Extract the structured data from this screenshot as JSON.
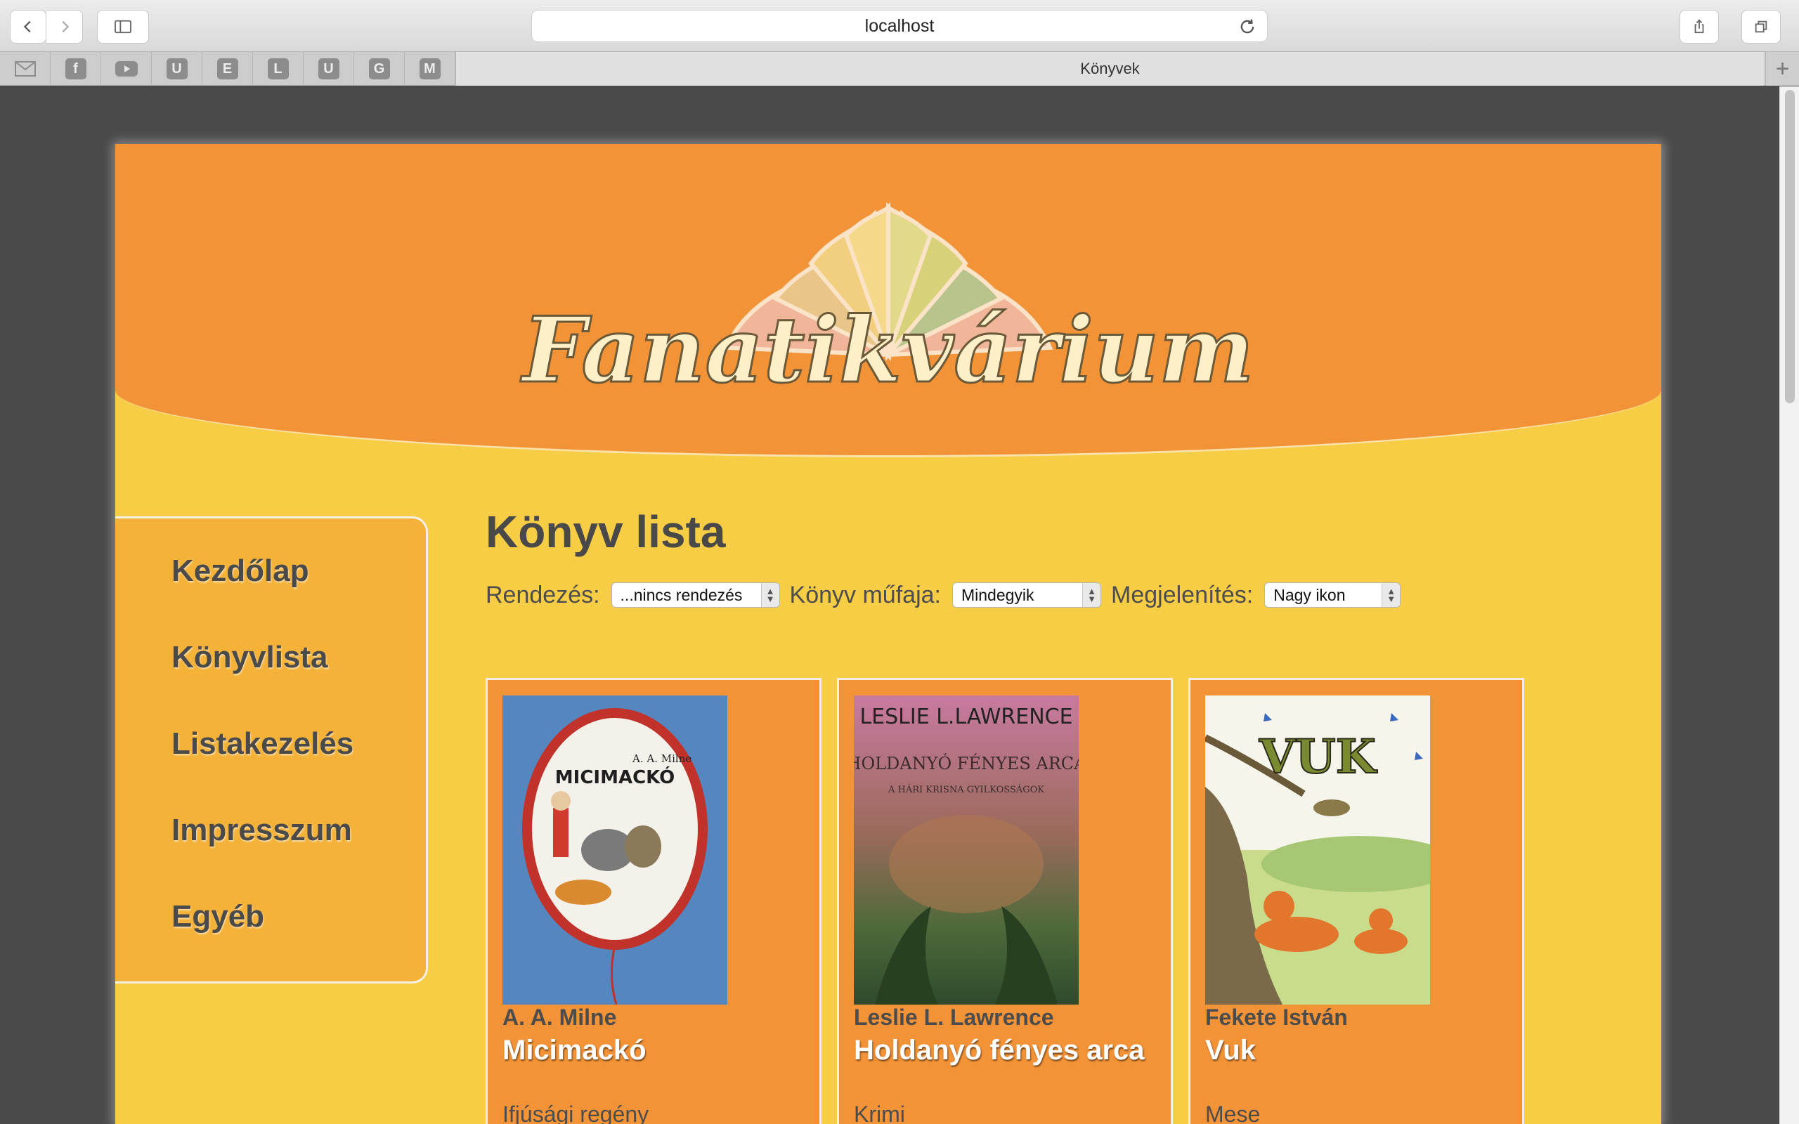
{
  "browser": {
    "url": "localhost",
    "tab_title": "Könyvek",
    "bookmarks": [
      "U",
      "E",
      "L",
      "U",
      "G",
      "M"
    ]
  },
  "site": {
    "logo_text": "Fanatikvárium"
  },
  "sidebar": {
    "items": [
      {
        "label": "Kezdőlap"
      },
      {
        "label": "Könyvlista"
      },
      {
        "label": "Listakezelés"
      },
      {
        "label": "Impresszum"
      },
      {
        "label": "Egyéb"
      }
    ]
  },
  "main": {
    "title": "Könyv lista",
    "filters": {
      "sort_label": "Rendezés:",
      "sort_value": "...nincs rendezés",
      "genre_label": "Könyv műfaja:",
      "genre_value": "Mindegyik",
      "view_label": "Megjelenítés:",
      "view_value": "Nagy ikon"
    },
    "books": [
      {
        "author": "A. A. Milne",
        "title": "Micimackó",
        "genre": "Ifjúsági regény",
        "cover_text": "MICIMACKÓ",
        "cover_author": "A. A. Milne"
      },
      {
        "author": "Leslie L. Lawrence",
        "title": "Holdanyó fényes arca",
        "genre": "Krimi",
        "cover_text": "HOLDANYÓ FÉNYES ARCA",
        "cover_author": "LESLIE L.LAWRENCE",
        "cover_sub": "A HÁRI KRISNA GYILKOSSÁGOK"
      },
      {
        "author": "Fekete István",
        "title": "Vuk",
        "genre": "Mese",
        "cover_text": "VUK"
      }
    ]
  }
}
